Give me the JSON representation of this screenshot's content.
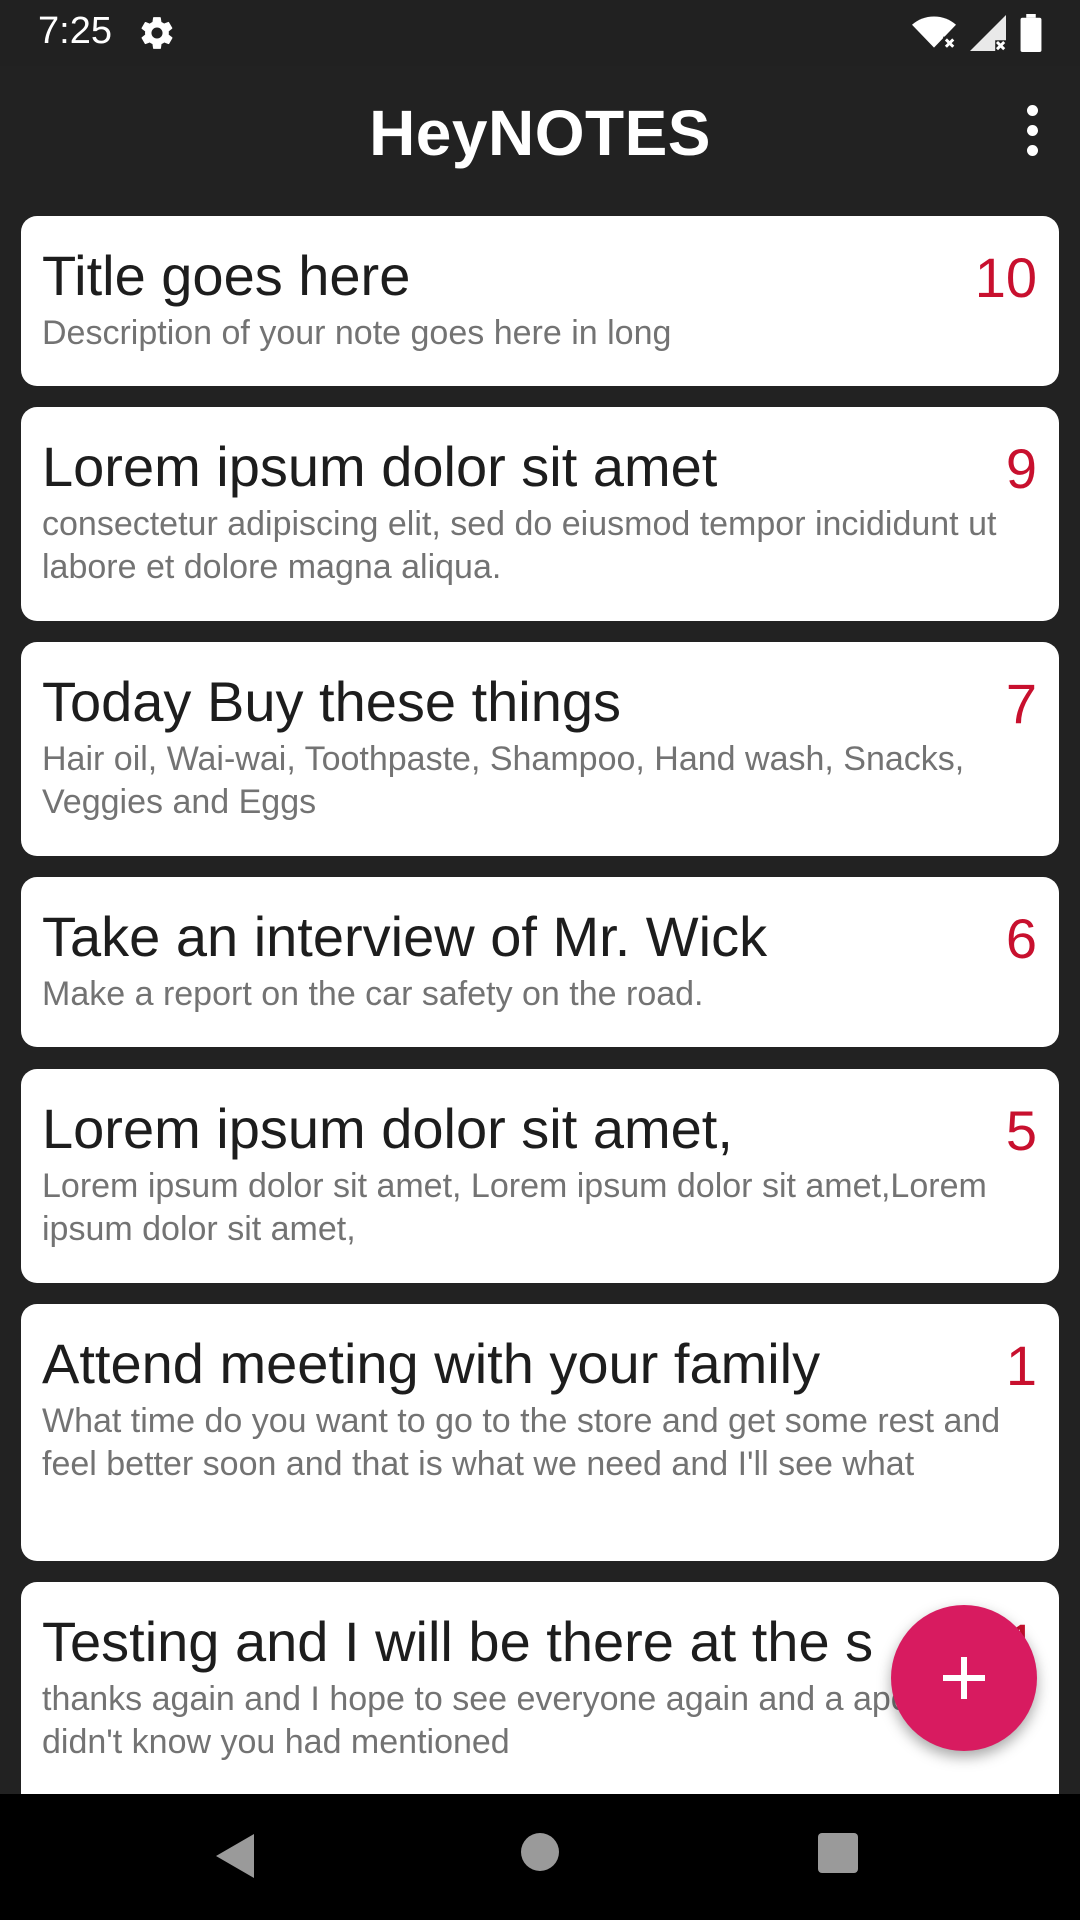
{
  "status_bar": {
    "time": "7:25",
    "icons": [
      "gear-icon",
      "wifi-icon",
      "signal-icon",
      "battery-icon"
    ]
  },
  "app_bar": {
    "title": "HeyNOTES",
    "menu_icon": "more-vert-icon"
  },
  "notes": [
    {
      "title": "Title goes here",
      "number": "10",
      "description": "Description of your note goes here in long"
    },
    {
      "title": "Lorem ipsum dolor sit amet",
      "number": "9",
      "description": "consectetur adipiscing elit, sed do eiusmod tempor incididunt ut labore et dolore magna aliqua."
    },
    {
      "title": "Today Buy these things",
      "number": "7",
      "description": "Hair oil, Wai-wai, Toothpaste, Shampoo, Hand wash, Snacks, Veggies and Eggs"
    },
    {
      "title": "Take an interview of Mr. Wick",
      "number": "6",
      "description": "Make a report on the car safety on the road."
    },
    {
      "title": "Lorem ipsum dolor sit amet,",
      "number": "5",
      "description": "Lorem ipsum dolor sit amet, Lorem ipsum dolor sit amet,Lorem ipsum dolor sit amet,"
    },
    {
      "title": "Attend meeting with your family",
      "number": "1",
      "description": "What time do you want to go to the store and get some rest and feel better soon and that is what we need and I'll see what"
    },
    {
      "title": "Testing and I will be there at the s",
      "number": "1",
      "description": "thanks again and I hope to see everyone again and a apologise I didn't know you had mentioned"
    }
  ],
  "fab": {
    "icon": "plus-icon"
  },
  "nav_bar": {
    "icons": [
      "back-icon",
      "home-icon",
      "recents-icon"
    ]
  },
  "colors": {
    "background": "#222222",
    "card": "#ffffff",
    "number": "#c8102e",
    "fab": "#d81b60"
  }
}
